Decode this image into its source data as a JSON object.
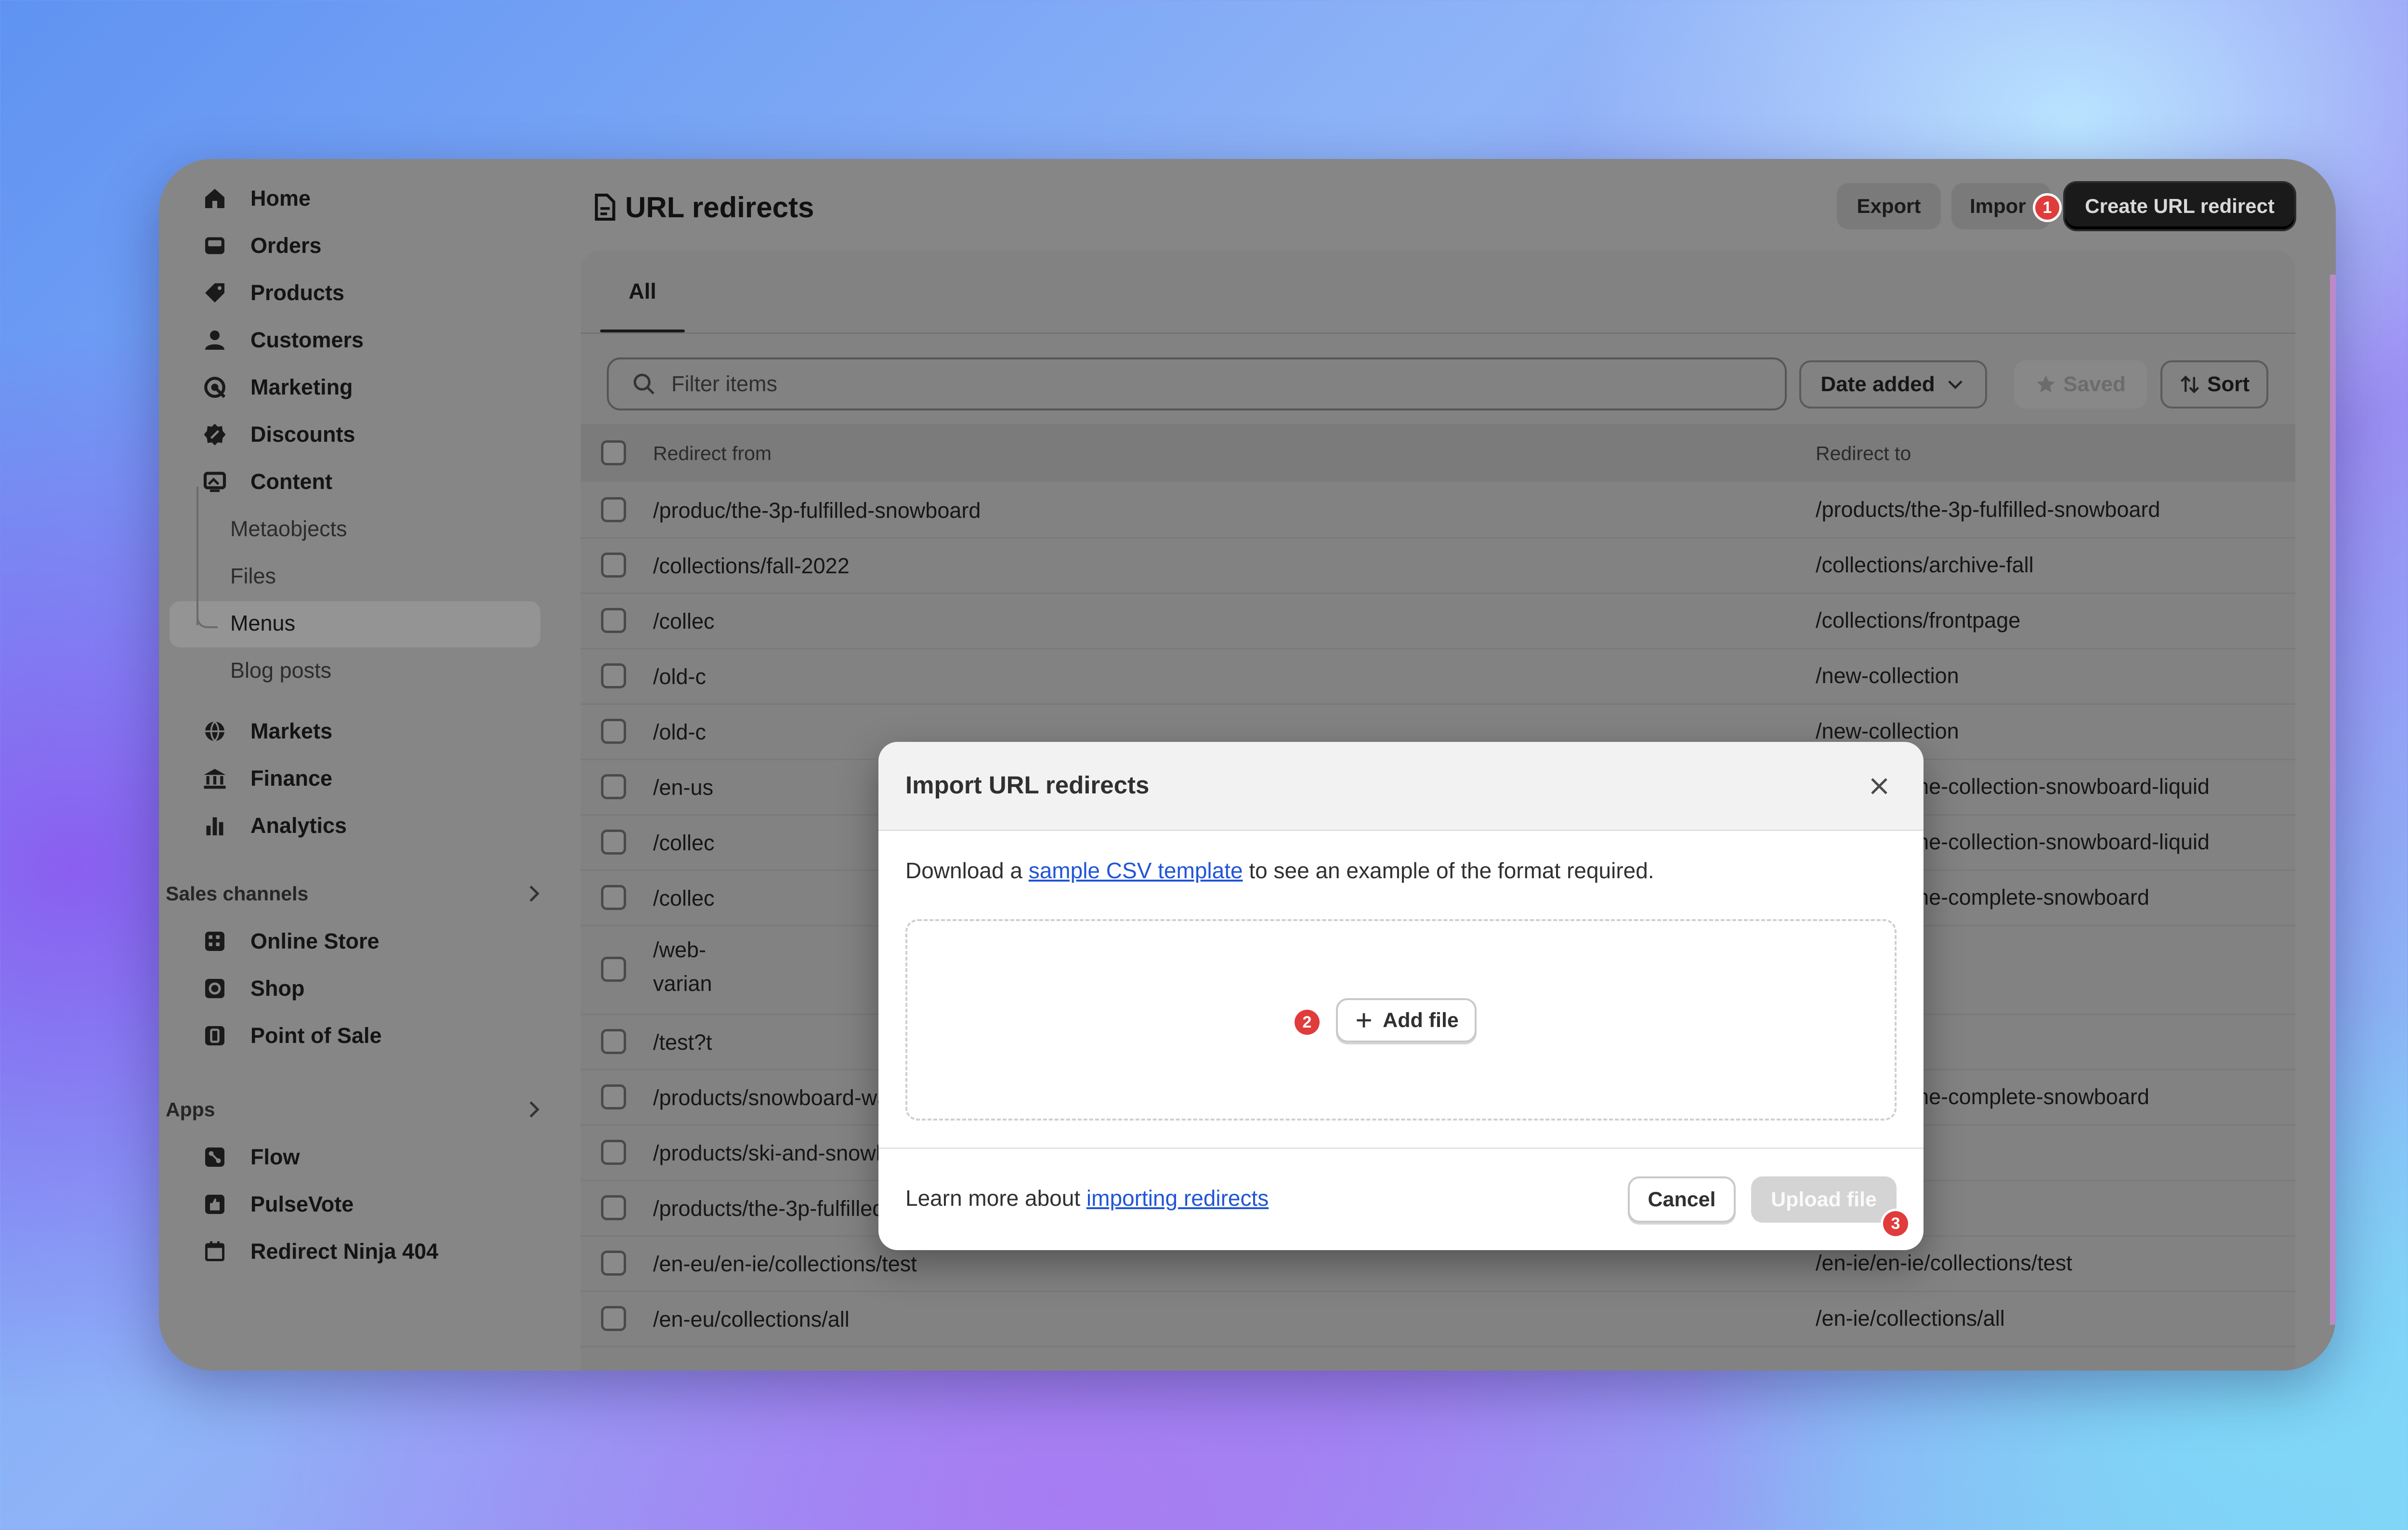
{
  "sidebar": {
    "items": [
      {
        "label": "Home",
        "icon": "home-icon"
      },
      {
        "label": "Orders",
        "icon": "inbox-icon"
      },
      {
        "label": "Products",
        "icon": "tag-icon"
      },
      {
        "label": "Customers",
        "icon": "person-icon"
      },
      {
        "label": "Marketing",
        "icon": "target-icon"
      },
      {
        "label": "Discounts",
        "icon": "discount-icon"
      },
      {
        "label": "Content",
        "icon": "image-icon"
      }
    ],
    "content_subitems": [
      "Metaobjects",
      "Files",
      "Menus",
      "Blog posts"
    ],
    "items2": [
      {
        "label": "Markets",
        "icon": "globe-icon"
      },
      {
        "label": "Finance",
        "icon": "bank-icon"
      },
      {
        "label": "Analytics",
        "icon": "bar-chart-icon"
      }
    ],
    "sales_channels": {
      "heading": "Sales channels",
      "items": [
        {
          "label": "Online Store",
          "icon": "store-icon"
        },
        {
          "label": "Shop",
          "icon": "shop-icon"
        },
        {
          "label": "Point of Sale",
          "icon": "pos-icon"
        }
      ]
    },
    "apps": {
      "heading": "Apps",
      "items": [
        {
          "label": "Flow",
          "icon": "flow-icon"
        },
        {
          "label": "PulseVote",
          "icon": "thumbs-up-icon"
        },
        {
          "label": "Redirect Ninja 404",
          "icon": "calendar-icon"
        }
      ]
    }
  },
  "header": {
    "title": "URL redirects",
    "export_label": "Export",
    "import_label": "Impor",
    "create_label": "Create URL redirect",
    "badge_1": "1"
  },
  "card": {
    "tab_all": "All",
    "filter_placeholder": "Filter items",
    "date_added_label": "Date added",
    "saved_label": "Saved",
    "sort_label": "Sort"
  },
  "table": {
    "col_from": "Redirect from",
    "col_to": "Redirect to",
    "rows": [
      {
        "from": "/produc/the-3p-fulfilled-snowboard",
        "to": "/products/the-3p-fulfilled-snowboard"
      },
      {
        "from": "/collections/fall-2022",
        "to": "/collections/archive-fall"
      },
      {
        "from": "/collec",
        "to": "/collections/frontpage"
      },
      {
        "from": "/old-c",
        "to": "/new-collection"
      },
      {
        "from": "/old-c",
        "to": "/new-collection"
      },
      {
        "from": "/en-us",
        "to": "/products/the-collection-snowboard-liquid"
      },
      {
        "from": "/collec",
        "to": "/products/the-collection-snowboard-liquid"
      },
      {
        "from": "/collec",
        "to": "/products/the-complete-snowboard"
      },
      {
        "from": "/web-",
        "from2": "varian",
        "to": "/"
      },
      {
        "from": "/test?t",
        "to": "/"
      },
      {
        "from": "/products/snowboard-wax",
        "to": "/products/the-complete-snowboard"
      },
      {
        "from": "/products/ski-and-snowboard-wax",
        "to": "/"
      },
      {
        "from": "/products/the-3p-fulfilled-skis",
        "to": "/"
      },
      {
        "from": "/en-eu/en-ie/collections/test",
        "to": "/en-ie/en-ie/collections/test"
      },
      {
        "from": "/en-eu/collections/all",
        "to": "/en-ie/collections/all"
      }
    ]
  },
  "modal": {
    "title": "Import URL redirects",
    "desc_before": "Download a ",
    "desc_link": "sample CSV template",
    "desc_after": " to see an example of the format required.",
    "add_file_label": "Add file",
    "badge_2": "2",
    "foot_before": "Learn more about ",
    "foot_link": "importing redirects",
    "cancel_label": "Cancel",
    "upload_label": "Upload file",
    "badge_3": "3"
  }
}
